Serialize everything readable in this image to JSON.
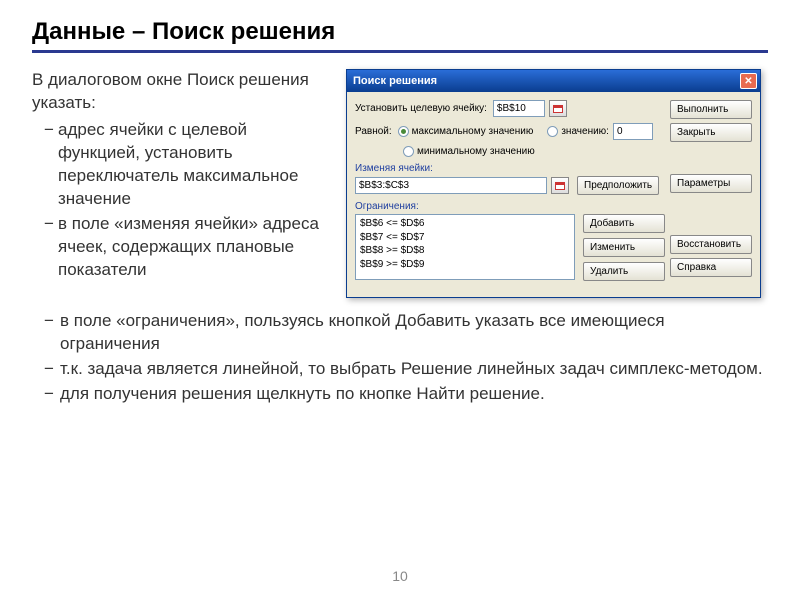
{
  "title": "Данные – Поиск решения",
  "intro": "В диалоговом окне Поиск решения указать:",
  "left_bullets": [
    "адрес ячейки с целевой функцией, установить переключатель максимальное значение",
    "в поле «изменяя ячейки» адреса ячеек, содержащих плановые показатели"
  ],
  "bottom_bullets": [
    "в поле «ограничения», пользуясь кнопкой Добавить указать все имеющиеся ограничения",
    "т.к. задача является линейной, то выбрать Решение линейных задач симплекс-методом.",
    "для получения решения щелкнуть по кнопке Найти решение."
  ],
  "page_number": "10",
  "dialog": {
    "title": "Поиск решения",
    "target_label": "Установить целевую ячейку:",
    "target_value": "$B$10",
    "equal_label": "Равной:",
    "radio_max": "максимальному значению",
    "radio_min": "минимальному значению",
    "radio_value": "значению:",
    "value_input": "0",
    "changing_label": "Изменяя ячейки:",
    "changing_value": "$B$3:$C$3",
    "guess_btn": "Предположить",
    "constraints_label": "Ограничения:",
    "constraints": [
      "$B$6 <= $D$6",
      "$B$7 <= $D$7",
      "$B$8 >= $D$8",
      "$B$9 >= $D$9"
    ],
    "btn_execute": "Выполнить",
    "btn_close": "Закрыть",
    "btn_params": "Параметры",
    "btn_restore": "Восстановить",
    "btn_help": "Справка",
    "btn_add": "Добавить",
    "btn_change": "Изменить",
    "btn_delete": "Удалить"
  }
}
